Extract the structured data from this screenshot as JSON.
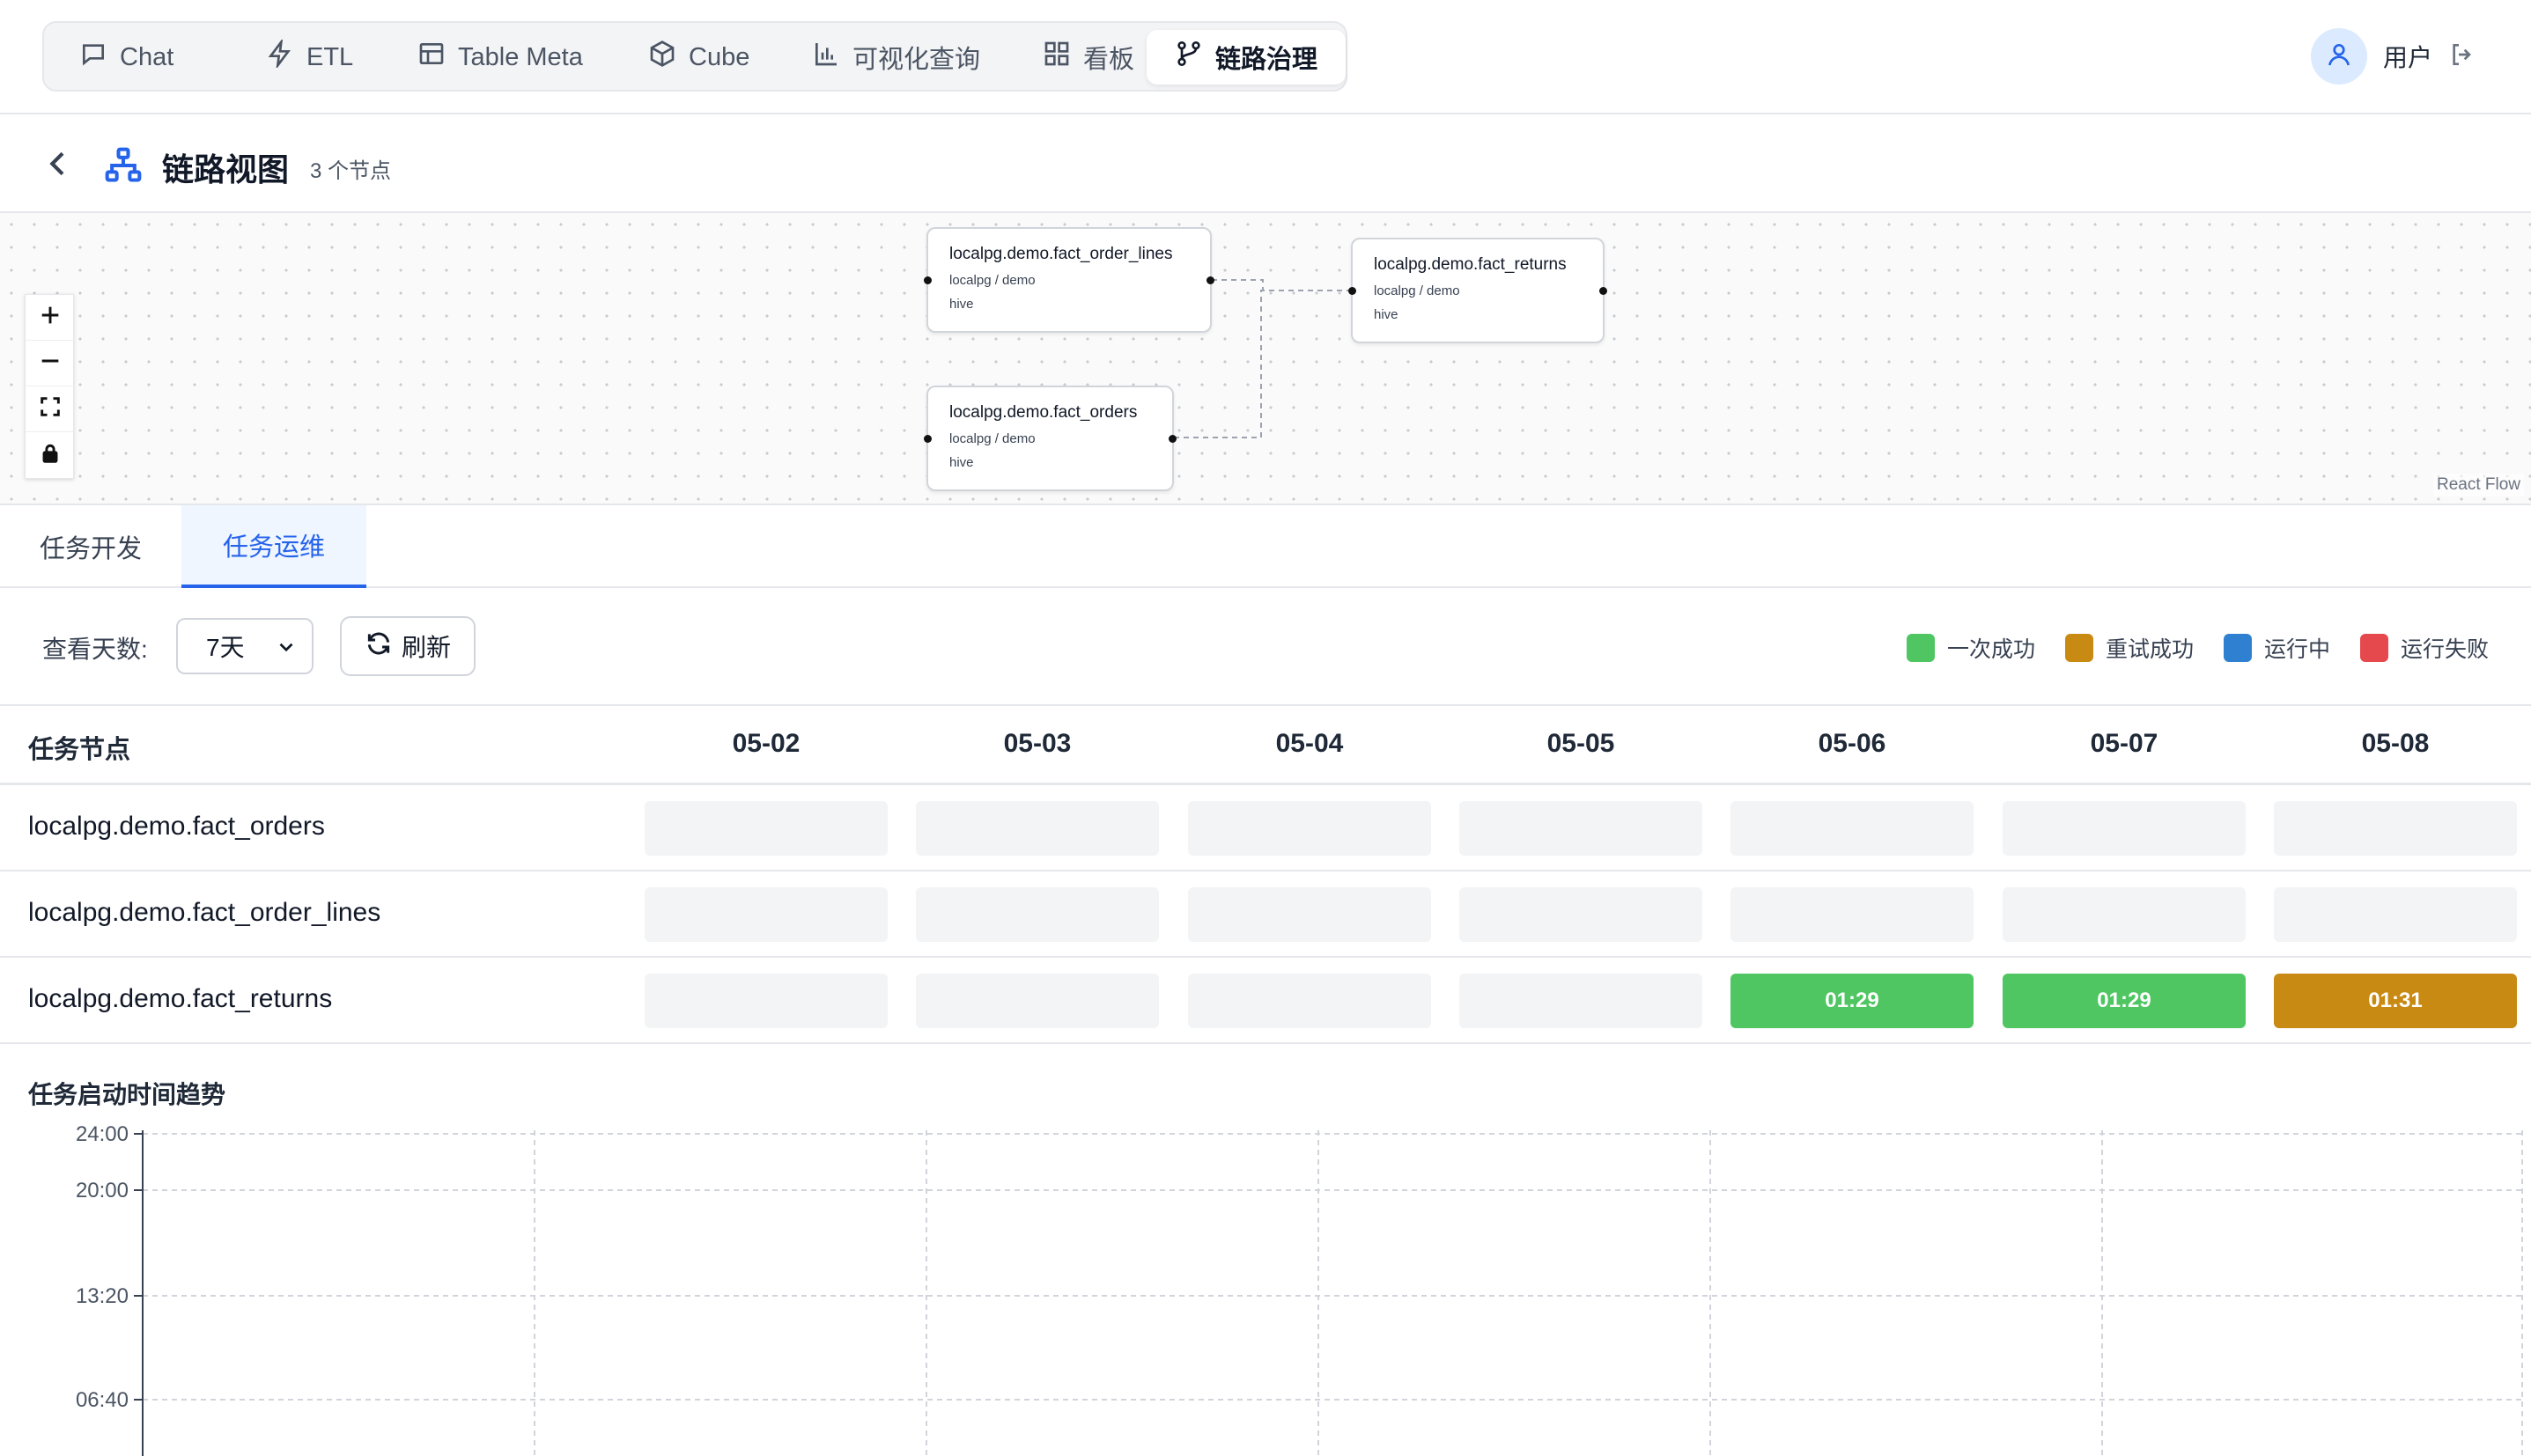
{
  "nav": {
    "items": [
      {
        "label": "Chat",
        "icon": "chat-icon"
      },
      {
        "label": "ETL",
        "icon": "lightning-icon"
      },
      {
        "label": "Table Meta",
        "icon": "table-icon"
      },
      {
        "label": "Cube",
        "icon": "cube-icon"
      },
      {
        "label": "可视化查询",
        "icon": "bar-chart-icon"
      },
      {
        "label": "看板",
        "icon": "dashboard-icon"
      },
      {
        "label": "链路治理",
        "icon": "branch-icon",
        "active": true
      }
    ],
    "user_label": "用户"
  },
  "header": {
    "title": "链路视图",
    "node_count": "3 个节点"
  },
  "flow": {
    "nodes": [
      {
        "title": "localpg.demo.fact_order_lines",
        "path": "localpg / demo",
        "type": "hive"
      },
      {
        "title": "localpg.demo.fact_returns",
        "path": "localpg / demo",
        "type": "hive"
      },
      {
        "title": "localpg.demo.fact_orders",
        "path": "localpg / demo",
        "type": "hive"
      }
    ],
    "attribution": "React Flow"
  },
  "tabs": [
    {
      "label": "任务开发",
      "active": false
    },
    {
      "label": "任务运维",
      "active": true
    }
  ],
  "toolbar": {
    "days_label": "查看天数:",
    "days_value": "7天",
    "refresh_label": "刷新"
  },
  "legend": [
    {
      "label": "一次成功",
      "color": "#4fc662"
    },
    {
      "label": "重试成功",
      "color": "#c88a12"
    },
    {
      "label": "运行中",
      "color": "#2f80d1"
    },
    {
      "label": "运行失败",
      "color": "#e5484d"
    }
  ],
  "grid": {
    "node_header": "任务节点",
    "dates": [
      "05-02",
      "05-03",
      "05-04",
      "05-05",
      "05-06",
      "05-07",
      "05-08"
    ],
    "rows": [
      {
        "name": "localpg.demo.fact_orders",
        "cells": [
          {
            "status": "none",
            "text": ""
          },
          {
            "status": "none",
            "text": ""
          },
          {
            "status": "none",
            "text": ""
          },
          {
            "status": "none",
            "text": ""
          },
          {
            "status": "none",
            "text": ""
          },
          {
            "status": "none",
            "text": ""
          },
          {
            "status": "none",
            "text": ""
          }
        ]
      },
      {
        "name": "localpg.demo.fact_order_lines",
        "cells": [
          {
            "status": "none",
            "text": ""
          },
          {
            "status": "none",
            "text": ""
          },
          {
            "status": "none",
            "text": ""
          },
          {
            "status": "none",
            "text": ""
          },
          {
            "status": "none",
            "text": ""
          },
          {
            "status": "none",
            "text": ""
          },
          {
            "status": "none",
            "text": ""
          }
        ]
      },
      {
        "name": "localpg.demo.fact_returns",
        "cells": [
          {
            "status": "none",
            "text": ""
          },
          {
            "status": "none",
            "text": ""
          },
          {
            "status": "none",
            "text": ""
          },
          {
            "status": "none",
            "text": ""
          },
          {
            "status": "success",
            "text": "01:29"
          },
          {
            "status": "success",
            "text": "01:29"
          },
          {
            "status": "retry",
            "text": "01:31"
          }
        ]
      }
    ]
  },
  "trend": {
    "title": "任务启动时间趋势",
    "y_ticks": [
      "24:00",
      "20:00",
      "13:20",
      "06:40"
    ]
  }
}
